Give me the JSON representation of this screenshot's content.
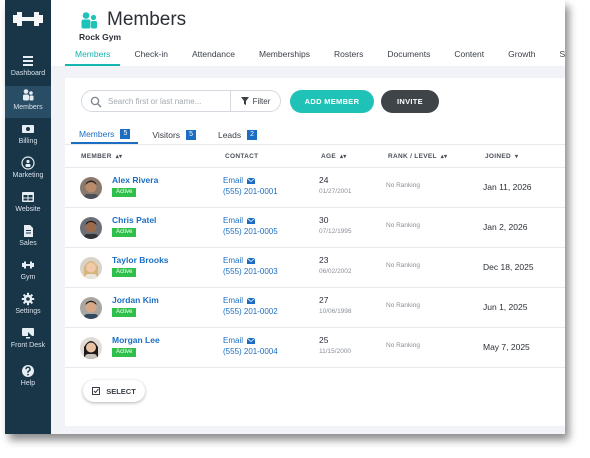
{
  "sidebar": {
    "items": [
      {
        "label": "Dashboard",
        "icon": "dashboard-icon"
      },
      {
        "label": "Members",
        "icon": "members-icon"
      },
      {
        "label": "Billing",
        "icon": "billing-icon"
      },
      {
        "label": "Marketing",
        "icon": "marketing-icon"
      },
      {
        "label": "Website",
        "icon": "website-icon"
      },
      {
        "label": "Sales",
        "icon": "sales-icon"
      },
      {
        "label": "Gym",
        "icon": "dumbbell-icon"
      },
      {
        "label": "Settings",
        "icon": "gear-icon"
      },
      {
        "label": "Front Desk",
        "icon": "front-desk-icon"
      },
      {
        "label": "Help",
        "icon": "help-icon"
      }
    ]
  },
  "header": {
    "title": "Members",
    "gym_name": "Rock Gym",
    "tabs": [
      "Members",
      "Check-in",
      "Attendance",
      "Memberships",
      "Rosters",
      "Documents",
      "Content",
      "Growth",
      "Settings"
    ]
  },
  "toolbar": {
    "search_placeholder": "Search first or last name...",
    "filter_label": "Filter",
    "add_member_label": "ADD MEMBER",
    "invite_label": "INVITE"
  },
  "subtabs": [
    {
      "label": "Members",
      "count": "5"
    },
    {
      "label": "Visitors",
      "count": "5"
    },
    {
      "label": "Leads",
      "count": "2"
    }
  ],
  "table": {
    "headers": {
      "member": "MEMBER",
      "contact": "CONTACT",
      "age": "AGE",
      "rank": "RANK / LEVEL",
      "joined": "JOINED"
    },
    "rows": [
      {
        "name": "Alex Rivera",
        "status": "Active",
        "email_label": "Email",
        "phone": "(555) 201-0001",
        "age": "24",
        "dob": "01/27/2001",
        "rank": "No Ranking",
        "joined": "Jan 11, 2026"
      },
      {
        "name": "Chris Patel",
        "status": "Active",
        "email_label": "Email",
        "phone": "(555) 201-0005",
        "age": "30",
        "dob": "07/12/1995",
        "rank": "No Ranking",
        "joined": "Jan 2, 2026"
      },
      {
        "name": "Taylor Brooks",
        "status": "Active",
        "email_label": "Email",
        "phone": "(555) 201-0003",
        "age": "23",
        "dob": "06/02/2002",
        "rank": "No Ranking",
        "joined": "Dec 18, 2025"
      },
      {
        "name": "Jordan Kim",
        "status": "Active",
        "email_label": "Email",
        "phone": "(555) 201-0002",
        "age": "27",
        "dob": "10/06/1998",
        "rank": "No Ranking",
        "joined": "Jun 1, 2025"
      },
      {
        "name": "Morgan Lee",
        "status": "Active",
        "email_label": "Email",
        "phone": "(555) 201-0004",
        "age": "25",
        "dob": "11/15/2000",
        "rank": "No Ranking",
        "joined": "May 7, 2025"
      }
    ]
  },
  "select_label": "SELECT",
  "colors": {
    "sidebar_bg": "#193548",
    "accent_teal": "#1fc2b6",
    "link_blue": "#1b6ec2",
    "active_green": "#2fbf4b",
    "invite_dark": "#3f4449"
  }
}
